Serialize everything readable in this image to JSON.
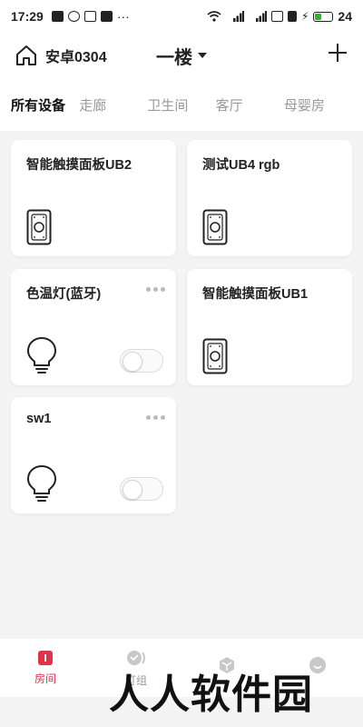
{
  "status_bar": {
    "time": "17:29",
    "battery": "24"
  },
  "header": {
    "home_name": "安卓0304",
    "floor": "一楼"
  },
  "tabs": [
    {
      "label": "所有设备",
      "active": true
    },
    {
      "label": "走廊"
    },
    {
      "label": "卫生间"
    },
    {
      "label": "客厅"
    },
    {
      "label": "母婴房"
    }
  ],
  "devices": [
    {
      "name": "智能触摸面板UB2",
      "icon": "touch-panel-icon"
    },
    {
      "name": "测试UB4  rgb",
      "icon": "touch-panel-icon"
    },
    {
      "name": "色温灯(蓝牙)",
      "icon": "bulb-icon",
      "switch_on": false
    },
    {
      "name": "智能触摸面板UB1",
      "icon": "touch-panel-icon"
    },
    {
      "name": "sw1",
      "icon": "bulb-icon",
      "switch_on": false
    }
  ],
  "bottom_nav": [
    {
      "label": "房间",
      "active": true
    },
    {
      "label": "灯组"
    },
    {
      "label": ""
    },
    {
      "label": ""
    }
  ],
  "watermark": "人人软件园",
  "colors": {
    "accent": "#e0334a",
    "inactive_tab": "#9a9a9a",
    "background": "#f4f4f4"
  }
}
